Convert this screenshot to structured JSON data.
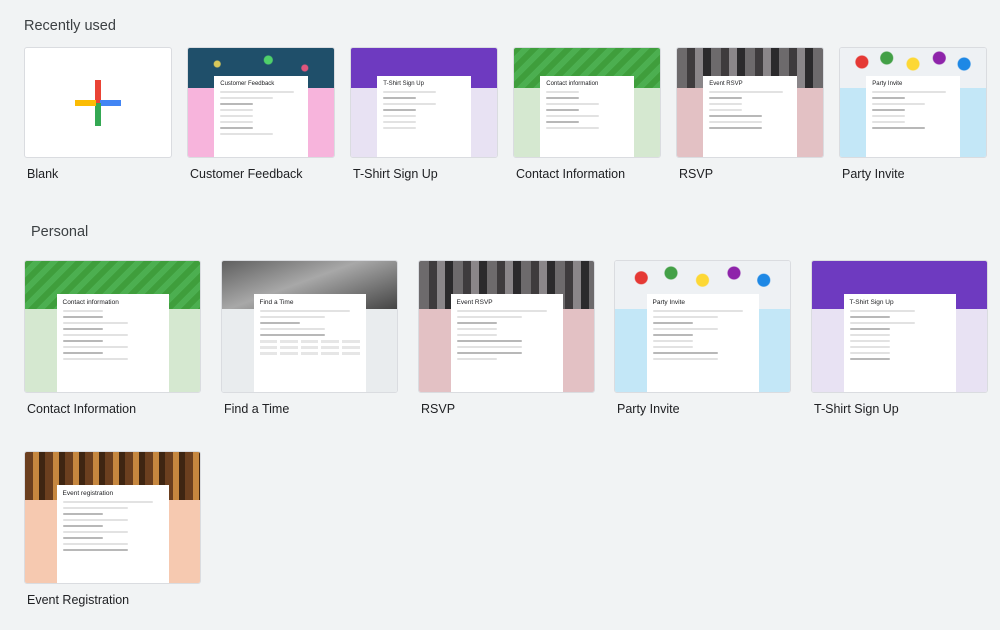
{
  "sections": {
    "recent_title": "Recently used",
    "personal_title": "Personal"
  },
  "recent": [
    {
      "label": "Blank"
    },
    {
      "label": "Customer Feedback",
      "card_title": "Customer Feedback"
    },
    {
      "label": "T-Shirt Sign Up",
      "card_title": "T-Shirt Sign Up"
    },
    {
      "label": "Contact Information",
      "card_title": "Contact information"
    },
    {
      "label": "RSVP",
      "card_title": "Event RSVP"
    },
    {
      "label": "Party Invite",
      "card_title": "Party Invite"
    }
  ],
  "personal": [
    {
      "label": "Contact Information",
      "card_title": "Contact information"
    },
    {
      "label": "Find a Time",
      "card_title": "Find a Time"
    },
    {
      "label": "RSVP",
      "card_title": "Event RSVP"
    },
    {
      "label": "Party Invite",
      "card_title": "Party Invite"
    },
    {
      "label": "T-Shirt Sign Up",
      "card_title": "T-Shirt Sign Up"
    },
    {
      "label": "Event Registration",
      "card_title": "Event registration"
    }
  ],
  "colors": {
    "background": "#f1f3f4",
    "green": "#4caf50",
    "purple": "#6e3ac0",
    "pink": "#f7b4dc",
    "light_green": "#d5e8d0",
    "lavender": "#e8e2f3",
    "rose": "#e3c1c4",
    "light_blue": "#c3e7f7",
    "peach": "#f6c9b0",
    "plus_red": "#ea4335",
    "plus_blue": "#4285f4",
    "plus_green": "#34a853",
    "plus_yellow": "#fbbc04"
  }
}
